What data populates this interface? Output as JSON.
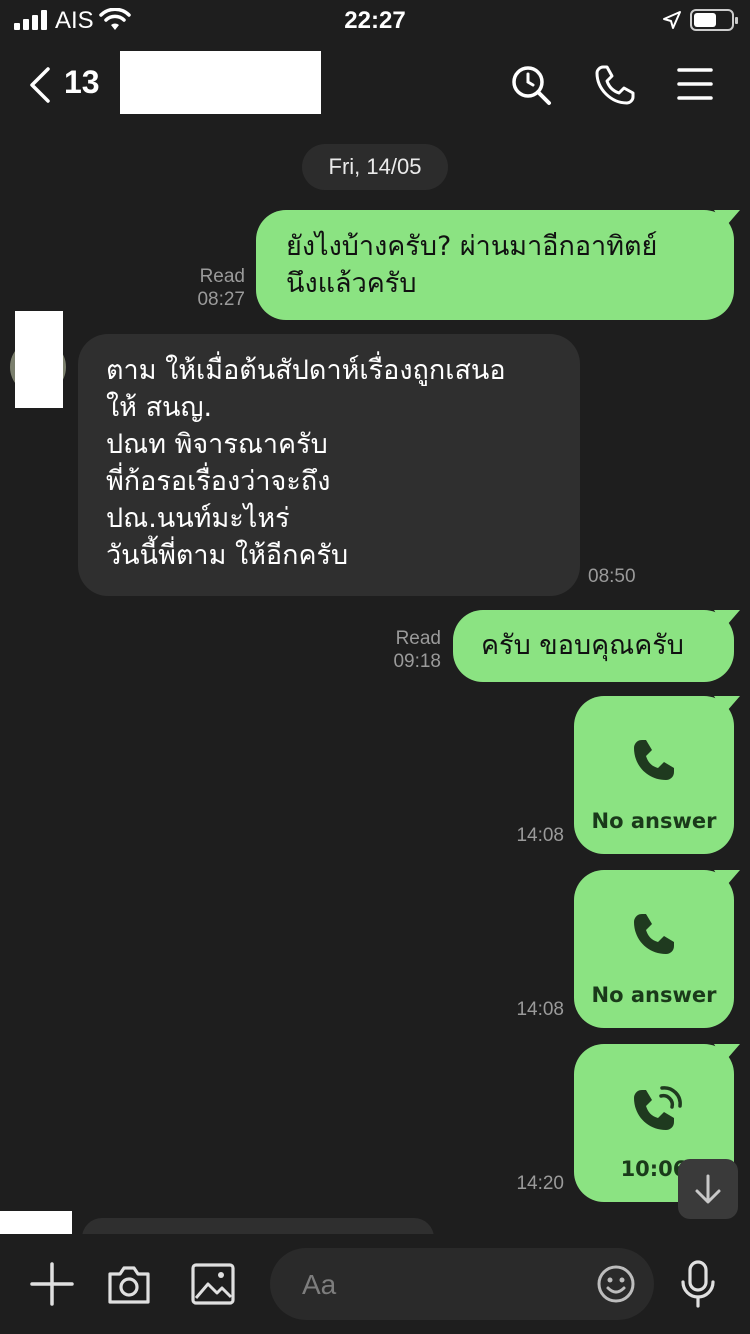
{
  "status_bar": {
    "carrier": "AIS",
    "time": "22:27",
    "signal_icon": "cellular-signal-icon",
    "wifi_icon": "wifi-icon",
    "location_icon": "location-arrow-icon",
    "battery_icon": "battery-icon"
  },
  "header": {
    "back_count": "13",
    "icons": [
      "back-chevron-icon",
      "search-icon",
      "phone-icon",
      "menu-icon"
    ]
  },
  "chat": {
    "date_separator": "Fri, 14/05",
    "messages": [
      {
        "direction": "outgoing",
        "text": "ยังไงบ้างครับ? ผ่านมาอีกอาทิตย์\nนึงแล้วครับ",
        "status": "Read",
        "time": "08:27"
      },
      {
        "direction": "incoming",
        "text": "ตาม ให้เมื่อต้นสัปดาห์เรื่องถูกเสนอ\nให้ สนญ.\nปณท พิจารณาครับ\nพี่ก้อรอเรื่องว่าจะถึง\nปณ.นนท์มะไหร่\nวันนี้พี่ตาม ให้อีกครับ",
        "time": "08:50"
      },
      {
        "direction": "outgoing",
        "text": "ครับ ขอบคุณครับ",
        "status": "Read",
        "time": "09:18"
      },
      {
        "direction": "outgoing",
        "type": "call",
        "label": "No answer",
        "icon": "phone-icon",
        "time": "14:08"
      },
      {
        "direction": "outgoing",
        "type": "call",
        "label": "No answer",
        "icon": "phone-icon",
        "time": "14:08"
      },
      {
        "direction": "outgoing",
        "type": "call",
        "label": "10:06",
        "icon": "phone-ringing-icon",
        "time": "14:20"
      }
    ]
  },
  "input_bar": {
    "placeholder": "Aa",
    "icons": [
      "plus-icon",
      "camera-icon",
      "image-icon",
      "emoji-icon",
      "microphone-icon"
    ]
  },
  "colors": {
    "background": "#1e1e1e",
    "outgoing_bubble": "#8be382",
    "incoming_bubble": "#2f2f2f",
    "meta_text": "#9a9a9a"
  }
}
